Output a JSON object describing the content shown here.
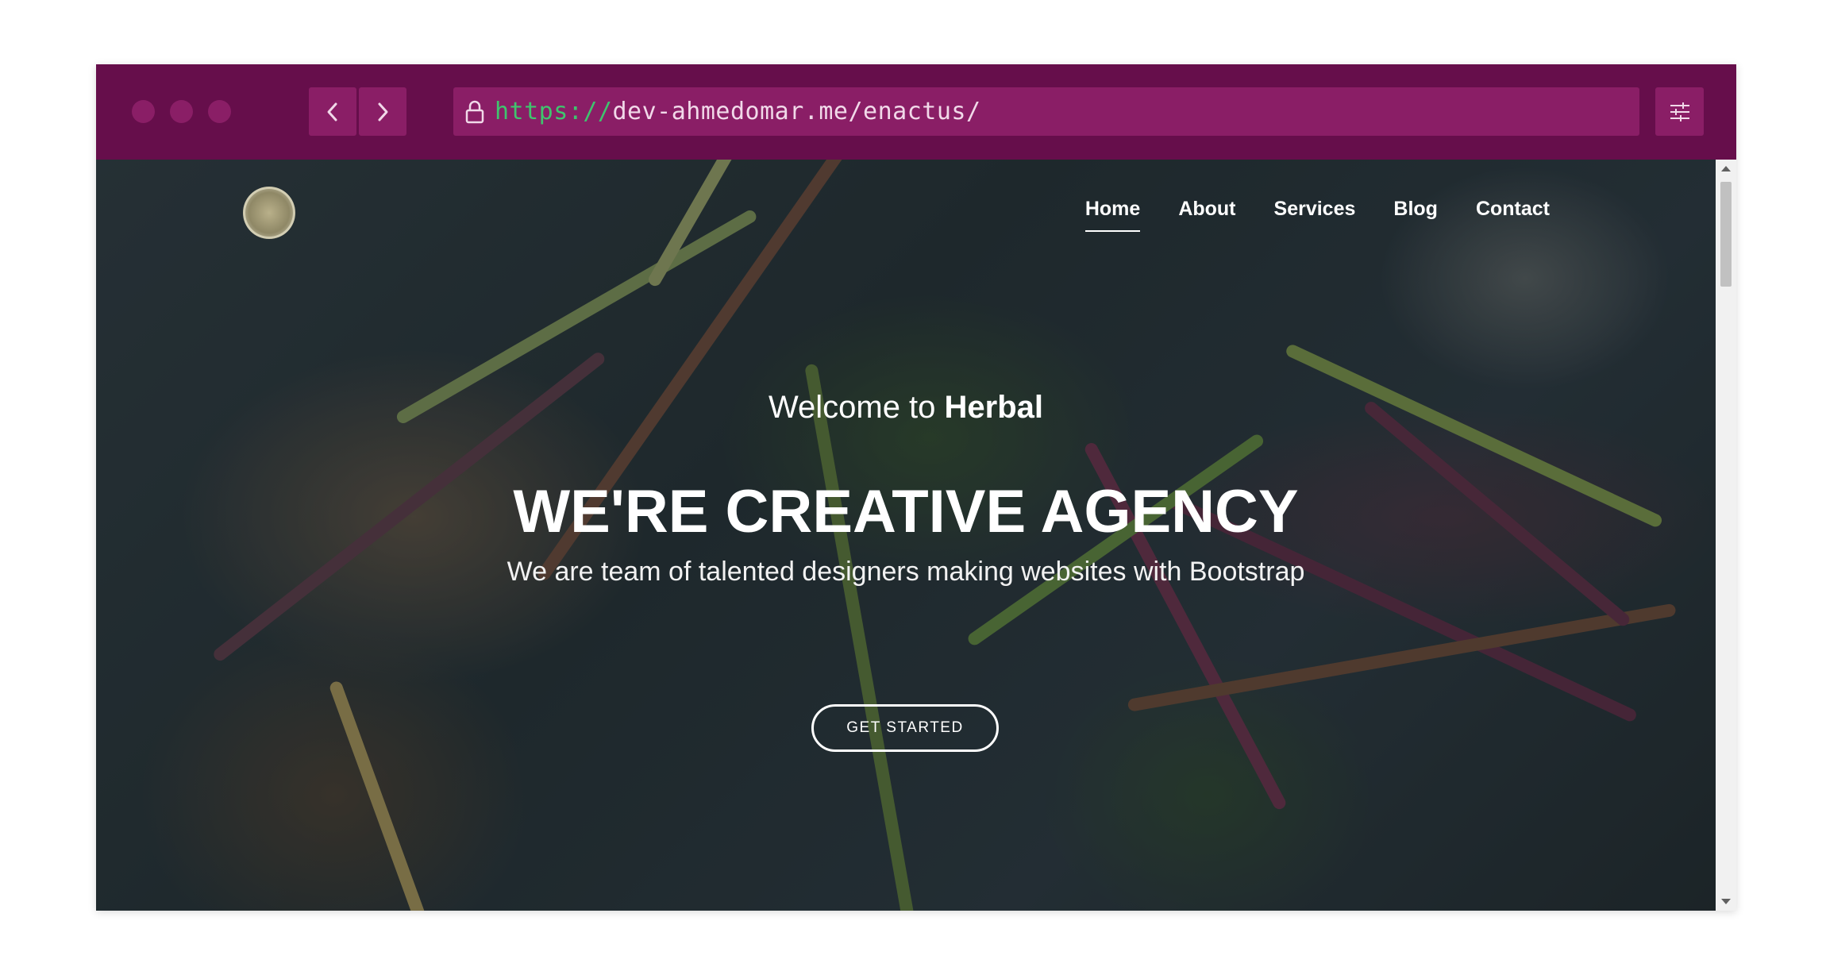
{
  "browser": {
    "url_scheme": "https://",
    "url_rest": "dev-ahmedomar.me/enactus/",
    "back_icon": "chevron-left-icon",
    "forward_icon": "chevron-right-icon",
    "lock_icon": "lock-icon",
    "settings_icon": "sliders-icon",
    "chrome_color": "#660e4b",
    "control_color": "#8a1e66"
  },
  "nav": {
    "items": [
      {
        "label": "Home",
        "active": true
      },
      {
        "label": "About"
      },
      {
        "label": "Services"
      },
      {
        "label": "Blog"
      },
      {
        "label": "Contact"
      }
    ]
  },
  "hero": {
    "welcome_prefix": "Welcome to ",
    "welcome_brand": "Herbal",
    "headline": "WE'RE CREATIVE AGENCY",
    "subline": "We are team of talented designers making websites with Bootstrap",
    "cta_label": "GET STARTED"
  }
}
